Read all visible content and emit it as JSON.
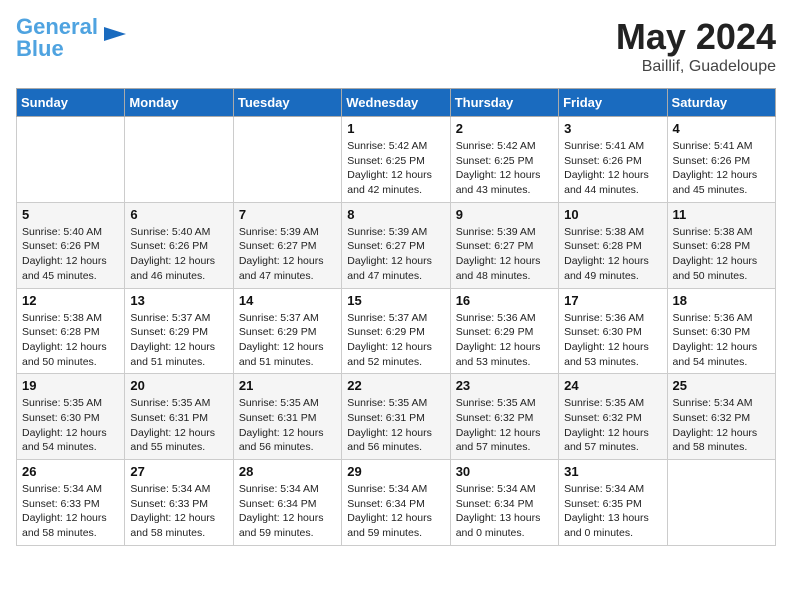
{
  "header": {
    "logo_line1": "General",
    "logo_line2": "Blue",
    "month": "May 2024",
    "location": "Baillif, Guadeloupe"
  },
  "weekdays": [
    "Sunday",
    "Monday",
    "Tuesday",
    "Wednesday",
    "Thursday",
    "Friday",
    "Saturday"
  ],
  "weeks": [
    [
      {
        "day": "",
        "sunrise": "",
        "sunset": "",
        "daylight": ""
      },
      {
        "day": "",
        "sunrise": "",
        "sunset": "",
        "daylight": ""
      },
      {
        "day": "",
        "sunrise": "",
        "sunset": "",
        "daylight": ""
      },
      {
        "day": "1",
        "sunrise": "Sunrise: 5:42 AM",
        "sunset": "Sunset: 6:25 PM",
        "daylight": "Daylight: 12 hours and 42 minutes."
      },
      {
        "day": "2",
        "sunrise": "Sunrise: 5:42 AM",
        "sunset": "Sunset: 6:25 PM",
        "daylight": "Daylight: 12 hours and 43 minutes."
      },
      {
        "day": "3",
        "sunrise": "Sunrise: 5:41 AM",
        "sunset": "Sunset: 6:26 PM",
        "daylight": "Daylight: 12 hours and 44 minutes."
      },
      {
        "day": "4",
        "sunrise": "Sunrise: 5:41 AM",
        "sunset": "Sunset: 6:26 PM",
        "daylight": "Daylight: 12 hours and 45 minutes."
      }
    ],
    [
      {
        "day": "5",
        "sunrise": "Sunrise: 5:40 AM",
        "sunset": "Sunset: 6:26 PM",
        "daylight": "Daylight: 12 hours and 45 minutes."
      },
      {
        "day": "6",
        "sunrise": "Sunrise: 5:40 AM",
        "sunset": "Sunset: 6:26 PM",
        "daylight": "Daylight: 12 hours and 46 minutes."
      },
      {
        "day": "7",
        "sunrise": "Sunrise: 5:39 AM",
        "sunset": "Sunset: 6:27 PM",
        "daylight": "Daylight: 12 hours and 47 minutes."
      },
      {
        "day": "8",
        "sunrise": "Sunrise: 5:39 AM",
        "sunset": "Sunset: 6:27 PM",
        "daylight": "Daylight: 12 hours and 47 minutes."
      },
      {
        "day": "9",
        "sunrise": "Sunrise: 5:39 AM",
        "sunset": "Sunset: 6:27 PM",
        "daylight": "Daylight: 12 hours and 48 minutes."
      },
      {
        "day": "10",
        "sunrise": "Sunrise: 5:38 AM",
        "sunset": "Sunset: 6:28 PM",
        "daylight": "Daylight: 12 hours and 49 minutes."
      },
      {
        "day": "11",
        "sunrise": "Sunrise: 5:38 AM",
        "sunset": "Sunset: 6:28 PM",
        "daylight": "Daylight: 12 hours and 50 minutes."
      }
    ],
    [
      {
        "day": "12",
        "sunrise": "Sunrise: 5:38 AM",
        "sunset": "Sunset: 6:28 PM",
        "daylight": "Daylight: 12 hours and 50 minutes."
      },
      {
        "day": "13",
        "sunrise": "Sunrise: 5:37 AM",
        "sunset": "Sunset: 6:29 PM",
        "daylight": "Daylight: 12 hours and 51 minutes."
      },
      {
        "day": "14",
        "sunrise": "Sunrise: 5:37 AM",
        "sunset": "Sunset: 6:29 PM",
        "daylight": "Daylight: 12 hours and 51 minutes."
      },
      {
        "day": "15",
        "sunrise": "Sunrise: 5:37 AM",
        "sunset": "Sunset: 6:29 PM",
        "daylight": "Daylight: 12 hours and 52 minutes."
      },
      {
        "day": "16",
        "sunrise": "Sunrise: 5:36 AM",
        "sunset": "Sunset: 6:29 PM",
        "daylight": "Daylight: 12 hours and 53 minutes."
      },
      {
        "day": "17",
        "sunrise": "Sunrise: 5:36 AM",
        "sunset": "Sunset: 6:30 PM",
        "daylight": "Daylight: 12 hours and 53 minutes."
      },
      {
        "day": "18",
        "sunrise": "Sunrise: 5:36 AM",
        "sunset": "Sunset: 6:30 PM",
        "daylight": "Daylight: 12 hours and 54 minutes."
      }
    ],
    [
      {
        "day": "19",
        "sunrise": "Sunrise: 5:35 AM",
        "sunset": "Sunset: 6:30 PM",
        "daylight": "Daylight: 12 hours and 54 minutes."
      },
      {
        "day": "20",
        "sunrise": "Sunrise: 5:35 AM",
        "sunset": "Sunset: 6:31 PM",
        "daylight": "Daylight: 12 hours and 55 minutes."
      },
      {
        "day": "21",
        "sunrise": "Sunrise: 5:35 AM",
        "sunset": "Sunset: 6:31 PM",
        "daylight": "Daylight: 12 hours and 56 minutes."
      },
      {
        "day": "22",
        "sunrise": "Sunrise: 5:35 AM",
        "sunset": "Sunset: 6:31 PM",
        "daylight": "Daylight: 12 hours and 56 minutes."
      },
      {
        "day": "23",
        "sunrise": "Sunrise: 5:35 AM",
        "sunset": "Sunset: 6:32 PM",
        "daylight": "Daylight: 12 hours and 57 minutes."
      },
      {
        "day": "24",
        "sunrise": "Sunrise: 5:35 AM",
        "sunset": "Sunset: 6:32 PM",
        "daylight": "Daylight: 12 hours and 57 minutes."
      },
      {
        "day": "25",
        "sunrise": "Sunrise: 5:34 AM",
        "sunset": "Sunset: 6:32 PM",
        "daylight": "Daylight: 12 hours and 58 minutes."
      }
    ],
    [
      {
        "day": "26",
        "sunrise": "Sunrise: 5:34 AM",
        "sunset": "Sunset: 6:33 PM",
        "daylight": "Daylight: 12 hours and 58 minutes."
      },
      {
        "day": "27",
        "sunrise": "Sunrise: 5:34 AM",
        "sunset": "Sunset: 6:33 PM",
        "daylight": "Daylight: 12 hours and 58 minutes."
      },
      {
        "day": "28",
        "sunrise": "Sunrise: 5:34 AM",
        "sunset": "Sunset: 6:34 PM",
        "daylight": "Daylight: 12 hours and 59 minutes."
      },
      {
        "day": "29",
        "sunrise": "Sunrise: 5:34 AM",
        "sunset": "Sunset: 6:34 PM",
        "daylight": "Daylight: 12 hours and 59 minutes."
      },
      {
        "day": "30",
        "sunrise": "Sunrise: 5:34 AM",
        "sunset": "Sunset: 6:34 PM",
        "daylight": "Daylight: 13 hours and 0 minutes."
      },
      {
        "day": "31",
        "sunrise": "Sunrise: 5:34 AM",
        "sunset": "Sunset: 6:35 PM",
        "daylight": "Daylight: 13 hours and 0 minutes."
      },
      {
        "day": "",
        "sunrise": "",
        "sunset": "",
        "daylight": ""
      }
    ]
  ]
}
